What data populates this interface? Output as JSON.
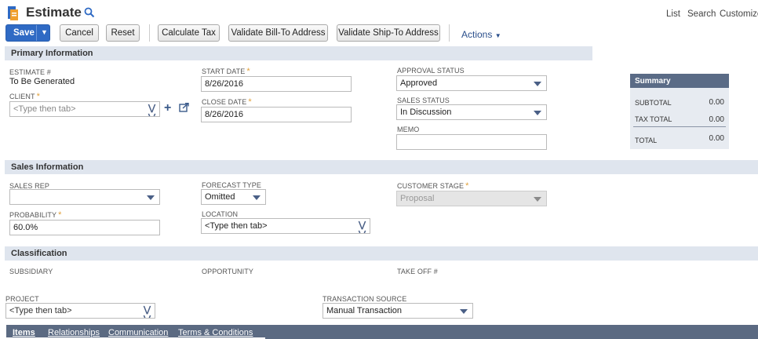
{
  "header": {
    "title": "Estimate",
    "links": [
      "List",
      "Search",
      "Customize"
    ]
  },
  "toolbar": {
    "save": "Save",
    "cancel": "Cancel",
    "reset": "Reset",
    "calculate_tax": "Calculate Tax",
    "validate_bill": "Validate Bill-To Address",
    "validate_ship": "Validate Ship-To Address",
    "actions": "Actions"
  },
  "primary": {
    "section_title": "Primary Information",
    "estimate_label": "ESTIMATE #",
    "estimate_value": "To Be Generated",
    "client_label": "CLIENT",
    "client_placeholder": "<Type then tab>",
    "start_date_label": "START DATE",
    "start_date_value": "8/26/2016",
    "close_date_label": "CLOSE DATE",
    "close_date_value": "8/26/2016",
    "approval_label": "APPROVAL STATUS",
    "approval_value": "Approved",
    "sales_status_label": "SALES STATUS",
    "sales_status_value": "In Discussion",
    "memo_label": "MEMO",
    "memo_value": ""
  },
  "summary": {
    "title": "Summary",
    "subtotal_label": "SUBTOTAL",
    "subtotal_value": "0.00",
    "tax_label": "TAX TOTAL",
    "tax_value": "0.00",
    "total_label": "TOTAL",
    "total_value": "0.00"
  },
  "sales": {
    "section_title": "Sales Information",
    "rep_label": "SALES REP",
    "rep_value": "",
    "forecast_label": "FORECAST TYPE",
    "forecast_value": "Omitted",
    "stage_label": "CUSTOMER STAGE",
    "stage_value": "Proposal",
    "probability_label": "PROBABILITY",
    "probability_value": "60.0%",
    "location_label": "LOCATION",
    "location_placeholder": "<Type then tab>"
  },
  "classification": {
    "section_title": "Classification",
    "subsidiary_label": "SUBSIDIARY",
    "opportunity_label": "OPPORTUNITY",
    "takeoff_label": "TAKE OFF #",
    "project_label": "PROJECT",
    "project_placeholder": "<Type then tab>",
    "source_label": "TRANSACTION SOURCE",
    "source_value": "Manual Transaction"
  },
  "tabs": [
    "Items",
    "Relationships",
    "Communication",
    "Terms & Conditions"
  ],
  "colors": {
    "primary_button": "#2f6ac4",
    "section_bg": "#dfe5ee",
    "tab_bar": "#5b6a82",
    "required": "#e1a03a"
  }
}
